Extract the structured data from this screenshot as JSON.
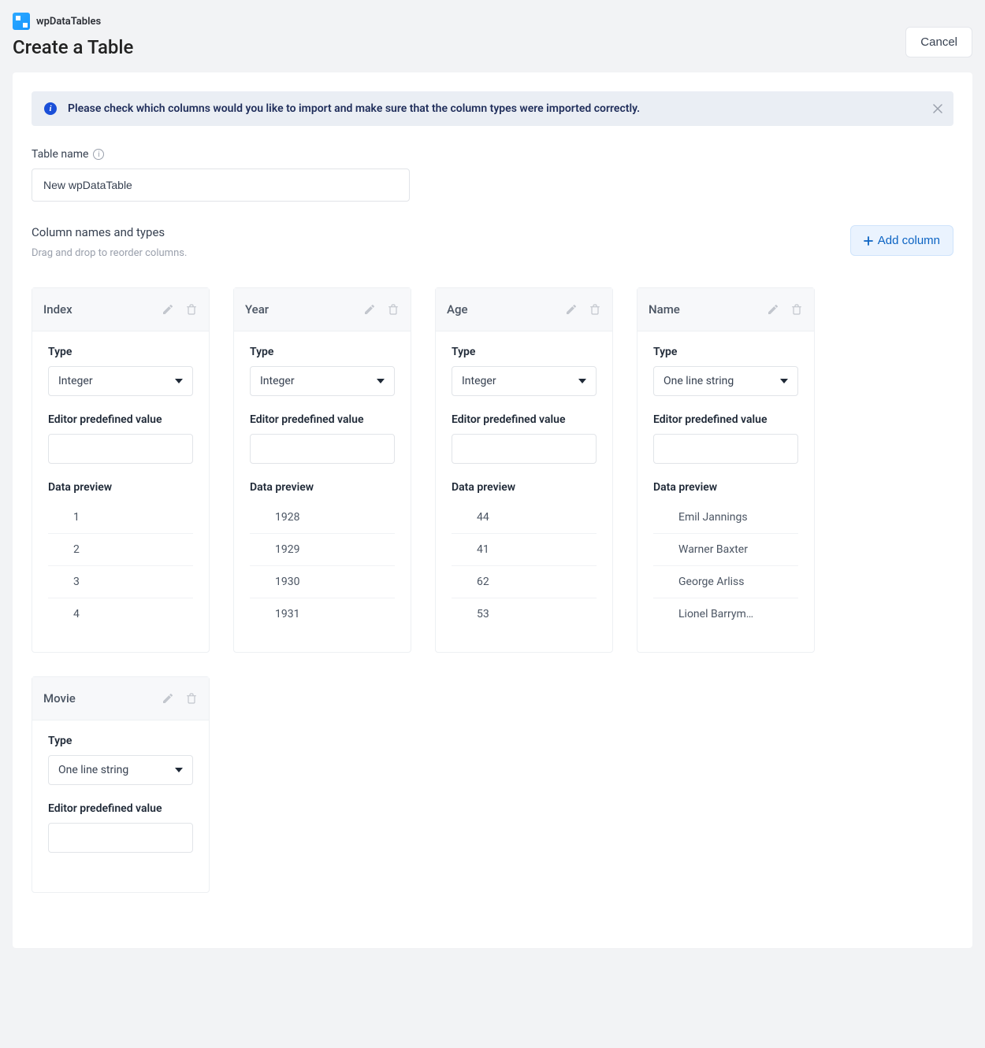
{
  "brand": {
    "name": "wpDataTables"
  },
  "page": {
    "title": "Create a Table"
  },
  "actions": {
    "cancel": "Cancel",
    "add_column": "Add column"
  },
  "notice": {
    "text": "Please check which columns would you like to import and make sure that the column types were imported correctly."
  },
  "table_name": {
    "label": "Table name",
    "value": "New wpDataTable"
  },
  "columns_section": {
    "heading": "Column names and types",
    "drag_hint": "Drag and drop to reorder columns."
  },
  "labels": {
    "type": "Type",
    "editor_predef": "Editor predefined value",
    "data_preview": "Data preview"
  },
  "columns": [
    {
      "name": "Index",
      "type": "Integer",
      "predef": "",
      "preview": [
        "1",
        "2",
        "3",
        "4"
      ]
    },
    {
      "name": "Year",
      "type": "Integer",
      "predef": "",
      "preview": [
        "1928",
        "1929",
        "1930",
        "1931"
      ]
    },
    {
      "name": "Age",
      "type": "Integer",
      "predef": "",
      "preview": [
        "44",
        "41",
        "62",
        "53"
      ]
    },
    {
      "name": "Name",
      "type": "One line string",
      "predef": "",
      "preview": [
        "Emil Jannings",
        "Warner Baxter",
        "George Arliss",
        "Lionel Barrym…"
      ]
    },
    {
      "name": "Movie",
      "type": "One line string",
      "predef": "",
      "preview": []
    }
  ]
}
